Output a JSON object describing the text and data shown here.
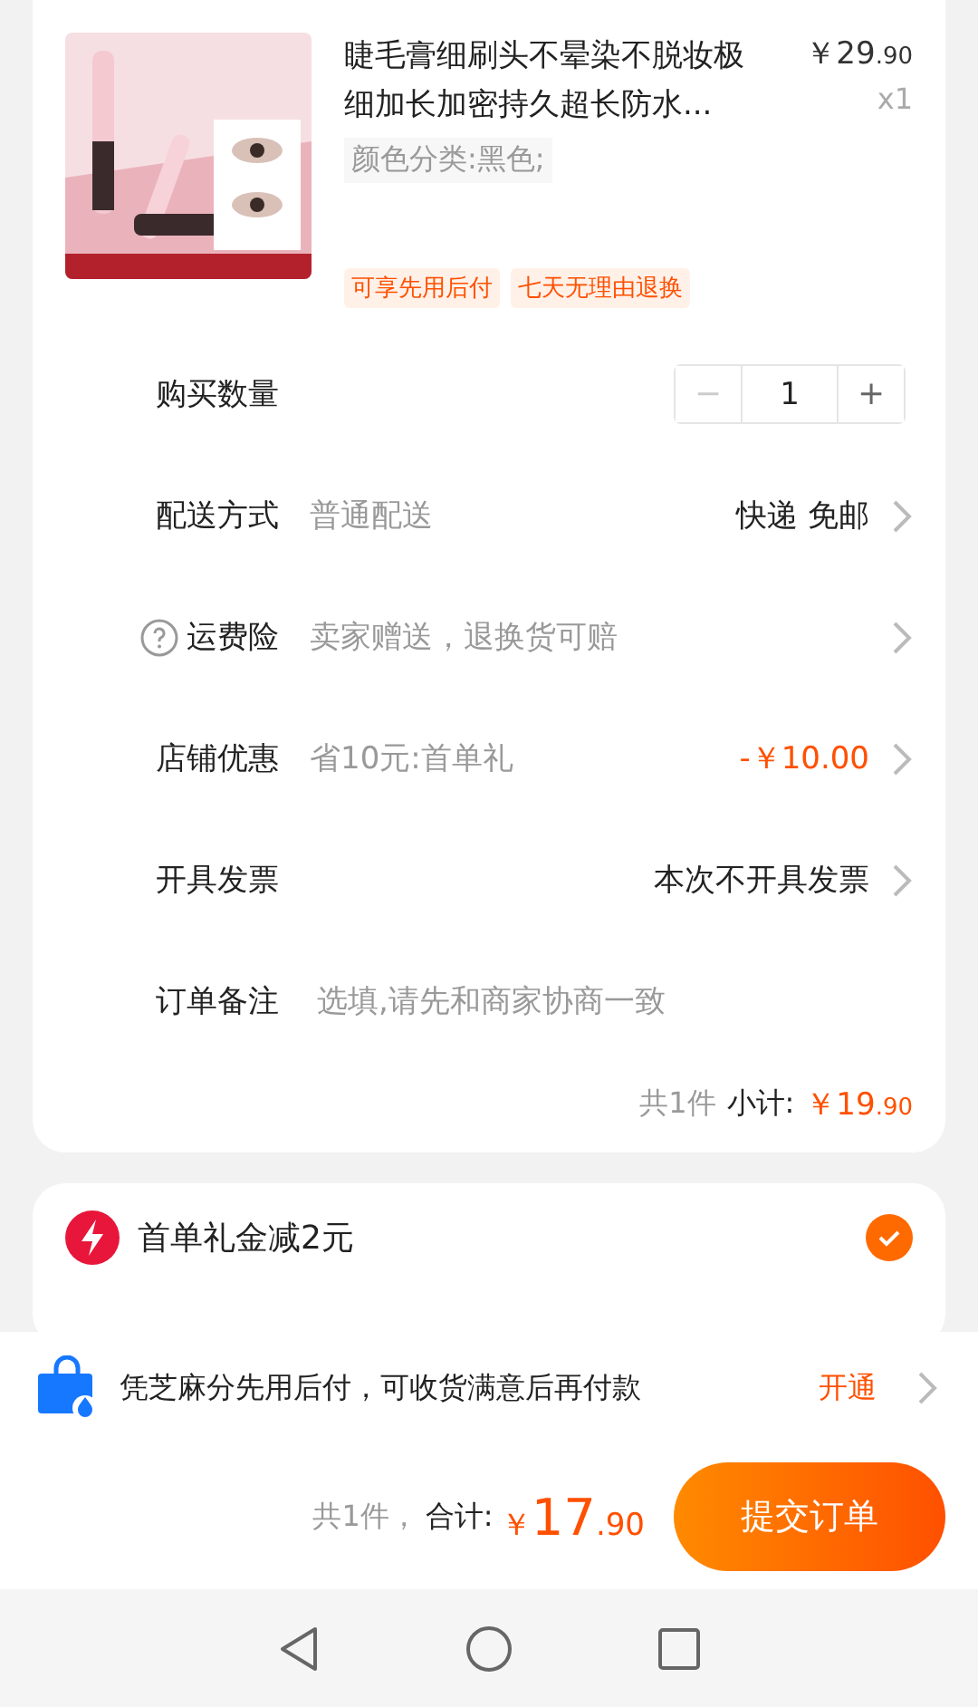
{
  "product": {
    "title": "睫毛膏细刷头不晕染不脱妆极细加长加密持久超长防水...",
    "price": {
      "symbol": "￥",
      "main": "29",
      "fraction": ".90"
    },
    "quantity": "x1",
    "variant": "颜色分类:黑色;",
    "tags": [
      "可享先用后付",
      "七天无理由退换"
    ]
  },
  "rows": [
    {
      "kind": "stepper",
      "label": "购买数量",
      "minus": "−",
      "value": "1",
      "plus": "+",
      "minus_disabled": true
    },
    {
      "kind": "link",
      "label": "配送方式",
      "detail": "普通配送",
      "value": "快递 免邮",
      "accent": false
    },
    {
      "kind": "link",
      "label": "运费险",
      "help": true,
      "detail": "卖家赠送，退换货可赔"
    },
    {
      "kind": "link",
      "label": "店铺优惠",
      "detail": "省10元:首单礼",
      "value": "-￥10.00",
      "accent": true
    },
    {
      "kind": "link",
      "label": "开具发票",
      "value": "本次不开具发票",
      "accent": false
    },
    {
      "kind": "input",
      "label": "订单备注",
      "placeholder": "选填,请先和商家协商一致"
    }
  ],
  "subtotal": {
    "count": "共1件",
    "label": "小计:",
    "price": {
      "symbol": "￥",
      "main": "19",
      "fraction": ".90"
    }
  },
  "coupon": {
    "text": "首单礼金减2元",
    "checked": true
  },
  "promo": {
    "text": "凭芝麻分先用后付，可收货满意后再付款",
    "action": "开通"
  },
  "footer": {
    "count": "共1件，",
    "label": "合计:",
    "price": {
      "symbol": "￥",
      "main": "17",
      "fraction": ".90"
    },
    "submit": "提交订单"
  }
}
